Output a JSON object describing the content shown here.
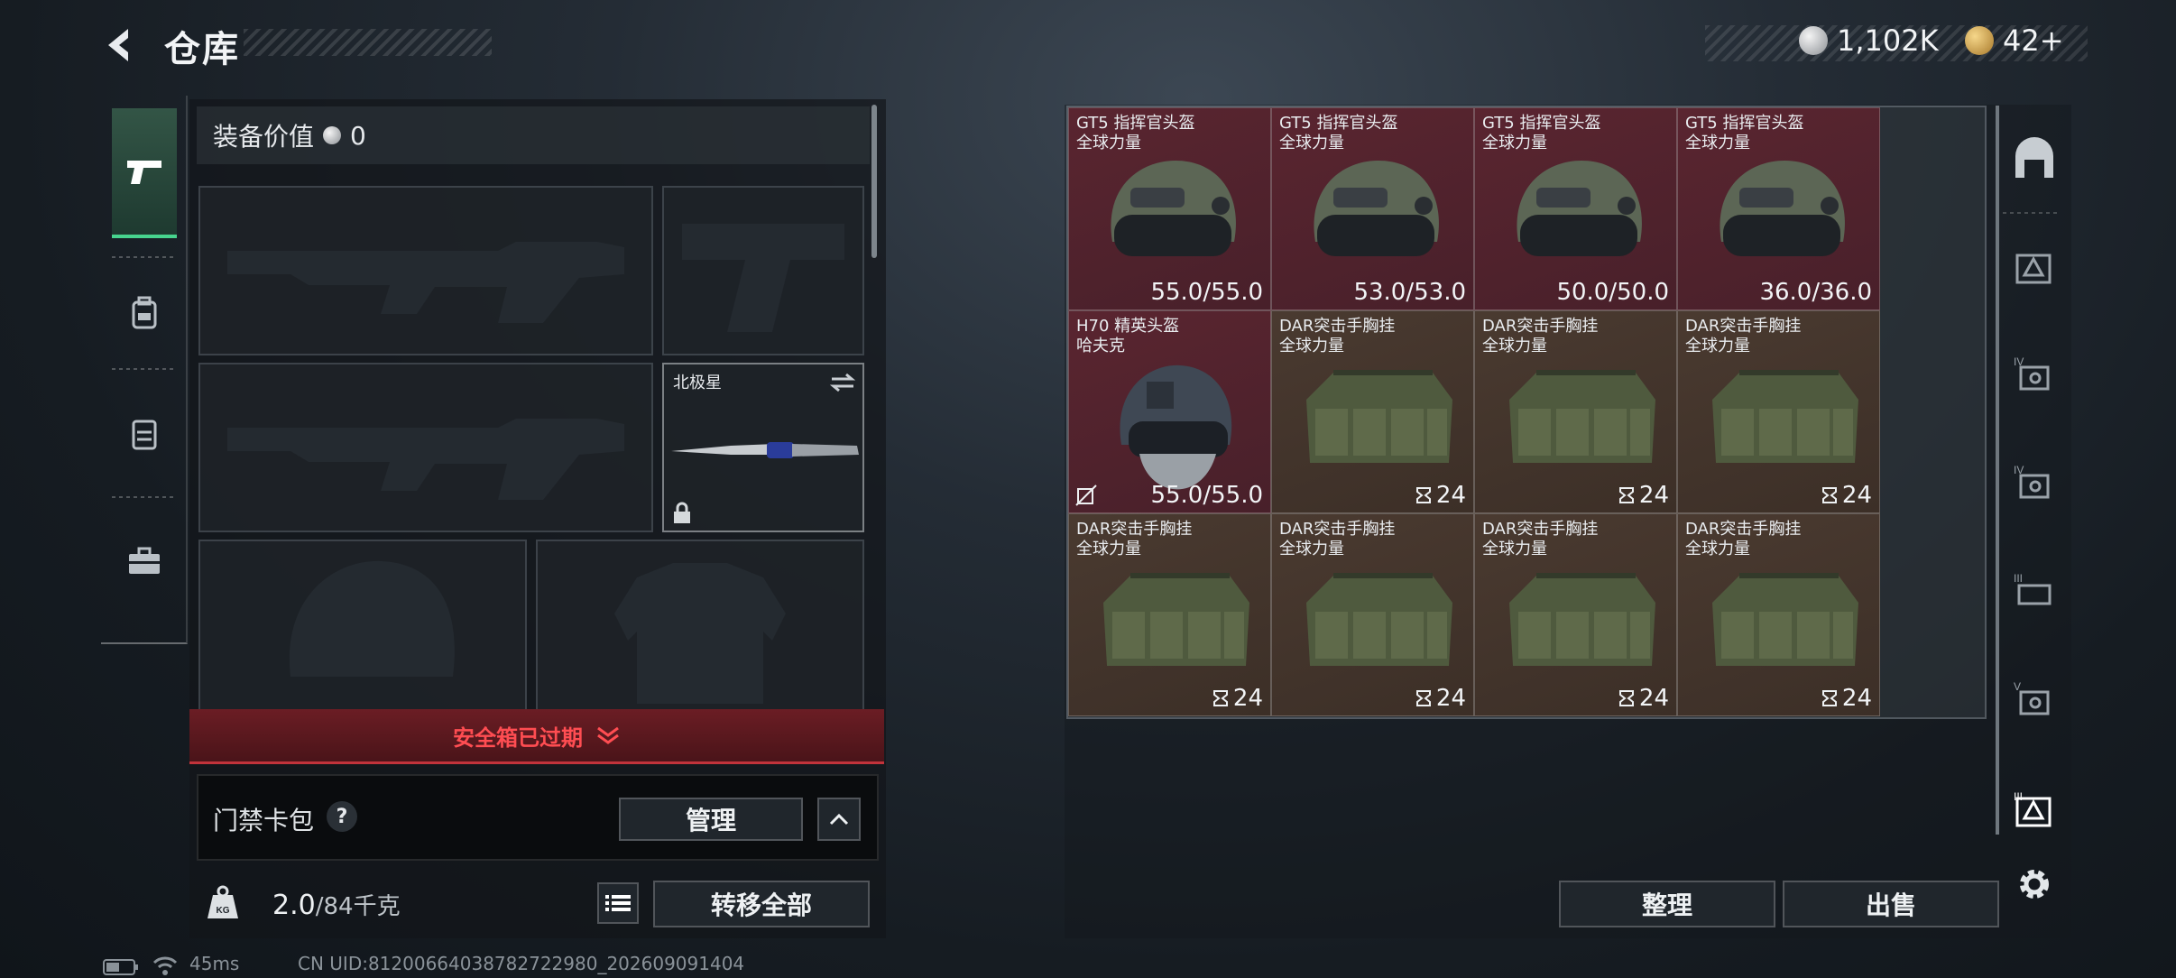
{
  "header": {
    "title": "仓库",
    "currency_silver": "1,102K",
    "currency_gold": "42+"
  },
  "nav": {
    "items": [
      "pistol-icon",
      "backpack-icon",
      "chest-rig-icon",
      "toolbox-icon"
    ]
  },
  "equipment": {
    "value_label": "装备价值",
    "value": "0",
    "slots": [
      {
        "name": "primary-weapon-slot"
      },
      {
        "name": "pistol-slot"
      },
      {
        "name": "secondary-weapon-slot"
      },
      {
        "name": "melee-slot",
        "label": "北极星"
      },
      {
        "name": "helmet-slot"
      },
      {
        "name": "armor-slot"
      }
    ],
    "safe_box_text": "安全箱已过期"
  },
  "keycard": {
    "label": "门禁卡包",
    "help": "?",
    "manage": "管理"
  },
  "weight": {
    "current": "2.0",
    "max": "/84千克",
    "transfer_all": "转移全部"
  },
  "grid": {
    "cells": [
      {
        "name1": "GT5 指挥官头盔",
        "name2": "全球力量",
        "value": "55.0/55.0",
        "kind": "helmet",
        "bg": "red"
      },
      {
        "name1": "GT5 指挥官头盔",
        "name2": "全球力量",
        "value": "53.0/53.0",
        "kind": "helmet",
        "bg": "red"
      },
      {
        "name1": "GT5 指挥官头盔",
        "name2": "全球力量",
        "value": "50.0/50.0",
        "kind": "helmet",
        "bg": "red"
      },
      {
        "name1": "GT5 指挥官头盔",
        "name2": "全球力量",
        "value": "36.0/36.0",
        "kind": "helmet",
        "bg": "red"
      },
      {
        "name1": "H70 精英头盔",
        "name2": "哈夫克",
        "value": "55.0/55.0",
        "kind": "helmet2",
        "bg": "red"
      },
      {
        "name1": "DAR突击手胸挂",
        "name2": "全球力量",
        "value": "24",
        "kind": "rig",
        "bg": "brown"
      },
      {
        "name1": "DAR突击手胸挂",
        "name2": "全球力量",
        "value": "24",
        "kind": "rig",
        "bg": "brown"
      },
      {
        "name1": "DAR突击手胸挂",
        "name2": "全球力量",
        "value": "24",
        "kind": "rig",
        "bg": "brown"
      },
      {
        "name1": "DAR突击手胸挂",
        "name2": "全球力量",
        "value": "24",
        "kind": "rig",
        "bg": "brown"
      },
      {
        "name1": "DAR突击手胸挂",
        "name2": "全球力量",
        "value": "24",
        "kind": "rig",
        "bg": "brown"
      },
      {
        "name1": "DAR突击手胸挂",
        "name2": "全球力量",
        "value": "24",
        "kind": "rig",
        "bg": "brown"
      },
      {
        "name1": "DAR突击手胸挂",
        "name2": "全球力量",
        "value": "24",
        "kind": "rig",
        "bg": "brown"
      }
    ]
  },
  "actions": {
    "sort": "整理",
    "sell": "出售"
  },
  "status": {
    "ping": "45ms",
    "uid": "CN UID:81200664038782722980_202609091404"
  },
  "colors": {
    "accent_green": "#47d48e",
    "warning_red": "#ff4d52",
    "cell_red": "#5a2530",
    "cell_brown": "#4a3a30"
  }
}
